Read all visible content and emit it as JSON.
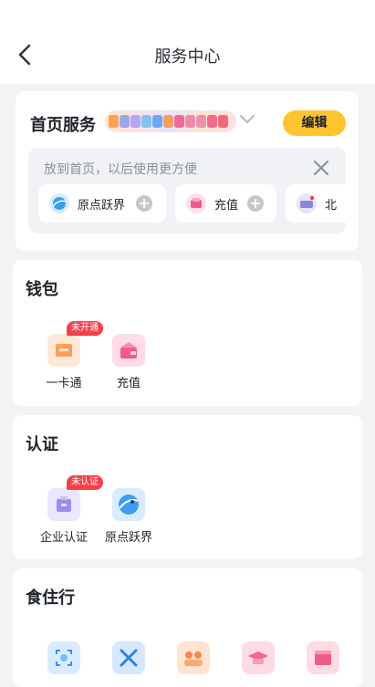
{
  "header": {
    "title": "服务中心",
    "back_icon": "chevron-left-icon"
  },
  "home_services": {
    "title": "首页服务",
    "edit_label": "编辑",
    "hint": "放到首页，以后使用更方便",
    "chips": [
      {
        "label": "原点跃界",
        "icon": "planet-icon"
      },
      {
        "label": "充值",
        "icon": "wallet-icon"
      },
      {
        "label": "北",
        "icon": "car-icon"
      }
    ]
  },
  "wallet": {
    "title": "钱包",
    "items": [
      {
        "label": "一卡通",
        "badge": "未开通",
        "icon": "card-icon"
      },
      {
        "label": "充值",
        "badge": "",
        "icon": "wallet-icon"
      }
    ]
  },
  "certification": {
    "title": "认证",
    "items": [
      {
        "label": "企业认证",
        "badge": "未认证",
        "icon": "building-icon"
      },
      {
        "label": "原点跃界",
        "badge": "",
        "icon": "planet-icon"
      }
    ]
  },
  "living": {
    "title": "食住行",
    "items": [
      {
        "icon": "scan-icon"
      },
      {
        "icon": "tools-icon"
      },
      {
        "icon": "people-icon"
      },
      {
        "icon": "graduation-cap-icon"
      },
      {
        "icon": "shop-icon"
      }
    ]
  },
  "colors": {
    "accent": "#ffc52e",
    "badge": "#f5404a",
    "page_bg": "#f2f3f5"
  }
}
